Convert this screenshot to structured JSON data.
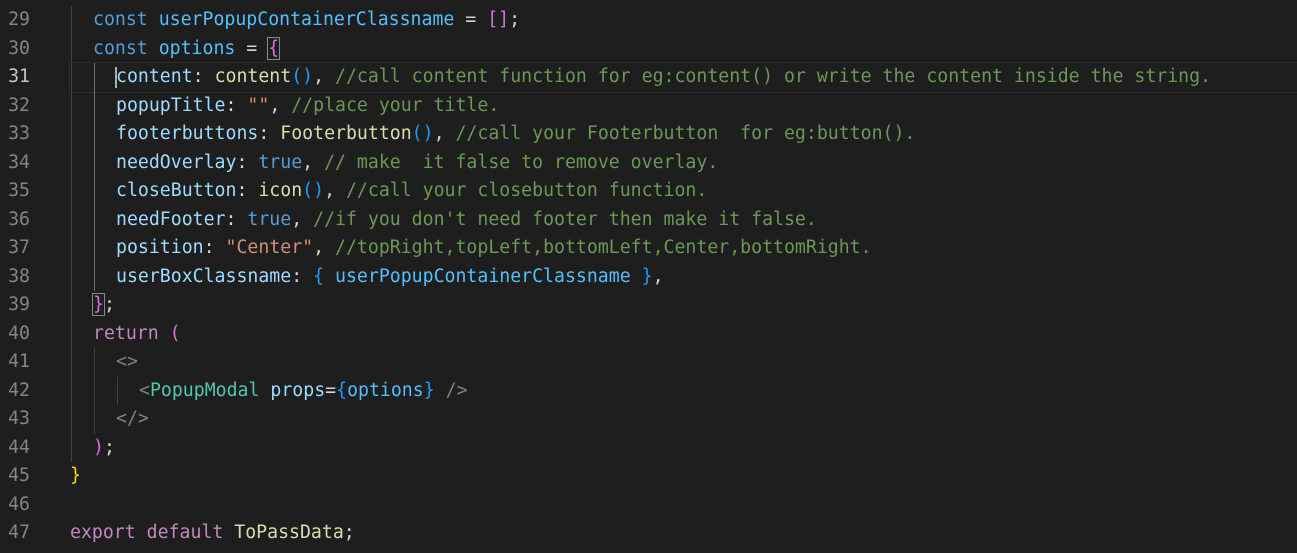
{
  "editor": {
    "current_line": "31",
    "lines": [
      {
        "num": "29",
        "indent": 1,
        "tokens": [
          {
            "t": "const",
            "c": "kw"
          },
          {
            "t": " "
          },
          {
            "t": "userPopupContainerClassname",
            "c": "id"
          },
          {
            "t": " = ",
            "c": "op"
          },
          {
            "t": "[]",
            "c": "b2"
          },
          {
            "t": ";",
            "c": "pun"
          }
        ]
      },
      {
        "num": "30",
        "indent": 1,
        "tokens": [
          {
            "t": "const",
            "c": "kw"
          },
          {
            "t": " "
          },
          {
            "t": "options",
            "c": "id"
          },
          {
            "t": " = ",
            "c": "op"
          },
          {
            "t": "{",
            "c": "b2",
            "hl": true
          }
        ]
      },
      {
        "num": "31",
        "indent": 2,
        "tokens": [
          {
            "t": "content",
            "c": "prop"
          },
          {
            "t": ": ",
            "c": "pun"
          },
          {
            "t": "content",
            "c": "fn"
          },
          {
            "t": "()",
            "c": "b3"
          },
          {
            "t": ", ",
            "c": "pun"
          },
          {
            "t": "//call content function for eg:content() or write the content inside the string.",
            "c": "cmt"
          }
        ]
      },
      {
        "num": "32",
        "indent": 2,
        "tokens": [
          {
            "t": "popupTitle",
            "c": "prop"
          },
          {
            "t": ": ",
            "c": "pun"
          },
          {
            "t": "\"\"",
            "c": "str"
          },
          {
            "t": ", ",
            "c": "pun"
          },
          {
            "t": "//place your title.",
            "c": "cmt"
          }
        ]
      },
      {
        "num": "33",
        "indent": 2,
        "tokens": [
          {
            "t": "footerbuttons",
            "c": "prop"
          },
          {
            "t": ": ",
            "c": "pun"
          },
          {
            "t": "Footerbutton",
            "c": "fn"
          },
          {
            "t": "()",
            "c": "b3"
          },
          {
            "t": ", ",
            "c": "pun"
          },
          {
            "t": "//call your Footerbutton  for eg:button().",
            "c": "cmt"
          }
        ]
      },
      {
        "num": "34",
        "indent": 2,
        "tokens": [
          {
            "t": "needOverlay",
            "c": "prop"
          },
          {
            "t": ": ",
            "c": "pun"
          },
          {
            "t": "true",
            "c": "kw"
          },
          {
            "t": ", ",
            "c": "pun"
          },
          {
            "t": "// make  it false to remove overlay.",
            "c": "cmt"
          }
        ]
      },
      {
        "num": "35",
        "indent": 2,
        "tokens": [
          {
            "t": "closeButton",
            "c": "prop"
          },
          {
            "t": ": ",
            "c": "pun"
          },
          {
            "t": "icon",
            "c": "fn"
          },
          {
            "t": "()",
            "c": "b3"
          },
          {
            "t": ", ",
            "c": "pun"
          },
          {
            "t": "//call your closebutton function.",
            "c": "cmt"
          }
        ]
      },
      {
        "num": "36",
        "indent": 2,
        "tokens": [
          {
            "t": "needFooter",
            "c": "prop"
          },
          {
            "t": ": ",
            "c": "pun"
          },
          {
            "t": "true",
            "c": "kw"
          },
          {
            "t": ", ",
            "c": "pun"
          },
          {
            "t": "//if you don't need footer then make it false.",
            "c": "cmt"
          }
        ]
      },
      {
        "num": "37",
        "indent": 2,
        "tokens": [
          {
            "t": "position",
            "c": "prop"
          },
          {
            "t": ": ",
            "c": "pun"
          },
          {
            "t": "\"Center\"",
            "c": "str"
          },
          {
            "t": ", ",
            "c": "pun"
          },
          {
            "t": "//topRight,topLeft,bottomLeft,Center,bottomRight.",
            "c": "cmt"
          }
        ]
      },
      {
        "num": "38",
        "indent": 2,
        "tokens": [
          {
            "t": "userBoxClassname",
            "c": "prop"
          },
          {
            "t": ": ",
            "c": "pun"
          },
          {
            "t": "{",
            "c": "b3"
          },
          {
            "t": " "
          },
          {
            "t": "userPopupContainerClassname",
            "c": "id"
          },
          {
            "t": " "
          },
          {
            "t": "}",
            "c": "b3"
          },
          {
            "t": ",",
            "c": "pun"
          }
        ]
      },
      {
        "num": "39",
        "indent": 1,
        "tokens": [
          {
            "t": "}",
            "c": "b2",
            "hl": true
          },
          {
            "t": ";",
            "c": "pun"
          }
        ]
      },
      {
        "num": "40",
        "indent": 1,
        "tokens": [
          {
            "t": "return",
            "c": "kw2"
          },
          {
            "t": " "
          },
          {
            "t": "(",
            "c": "b2"
          }
        ]
      },
      {
        "num": "41",
        "indent": 2,
        "tokens": [
          {
            "t": "<>",
            "c": "tag"
          }
        ]
      },
      {
        "num": "42",
        "indent": 3,
        "tokens": [
          {
            "t": "<",
            "c": "tag"
          },
          {
            "t": "PopupModal",
            "c": "cmp"
          },
          {
            "t": " "
          },
          {
            "t": "props",
            "c": "attr"
          },
          {
            "t": "=",
            "c": "op"
          },
          {
            "t": "{",
            "c": "b3"
          },
          {
            "t": "options",
            "c": "id"
          },
          {
            "t": "}",
            "c": "b3"
          },
          {
            "t": " "
          },
          {
            "t": "/>",
            "c": "tag"
          }
        ]
      },
      {
        "num": "43",
        "indent": 2,
        "tokens": [
          {
            "t": "</>",
            "c": "tag"
          }
        ]
      },
      {
        "num": "44",
        "indent": 1,
        "tokens": [
          {
            "t": ")",
            "c": "b2"
          },
          {
            "t": ";",
            "c": "pun"
          }
        ]
      },
      {
        "num": "45",
        "indent": 0,
        "tokens": [
          {
            "t": "}",
            "c": "b1"
          }
        ]
      },
      {
        "num": "46",
        "indent": 0,
        "tokens": []
      },
      {
        "num": "47",
        "indent": 0,
        "tokens": [
          {
            "t": "export",
            "c": "kw2"
          },
          {
            "t": " "
          },
          {
            "t": "default",
            "c": "kw2"
          },
          {
            "t": " "
          },
          {
            "t": "ToPassData",
            "c": "cls"
          },
          {
            "t": ";",
            "c": "pun"
          }
        ]
      }
    ]
  },
  "colors": {
    "background": "#1e1e1e",
    "line_number": "#858585",
    "keyword": "#569cd6",
    "control_keyword": "#c586c0",
    "comment": "#6a9955",
    "string": "#ce9178",
    "function": "#dcdcaa",
    "property": "#9cdcfe",
    "component": "#4ec9b0"
  }
}
